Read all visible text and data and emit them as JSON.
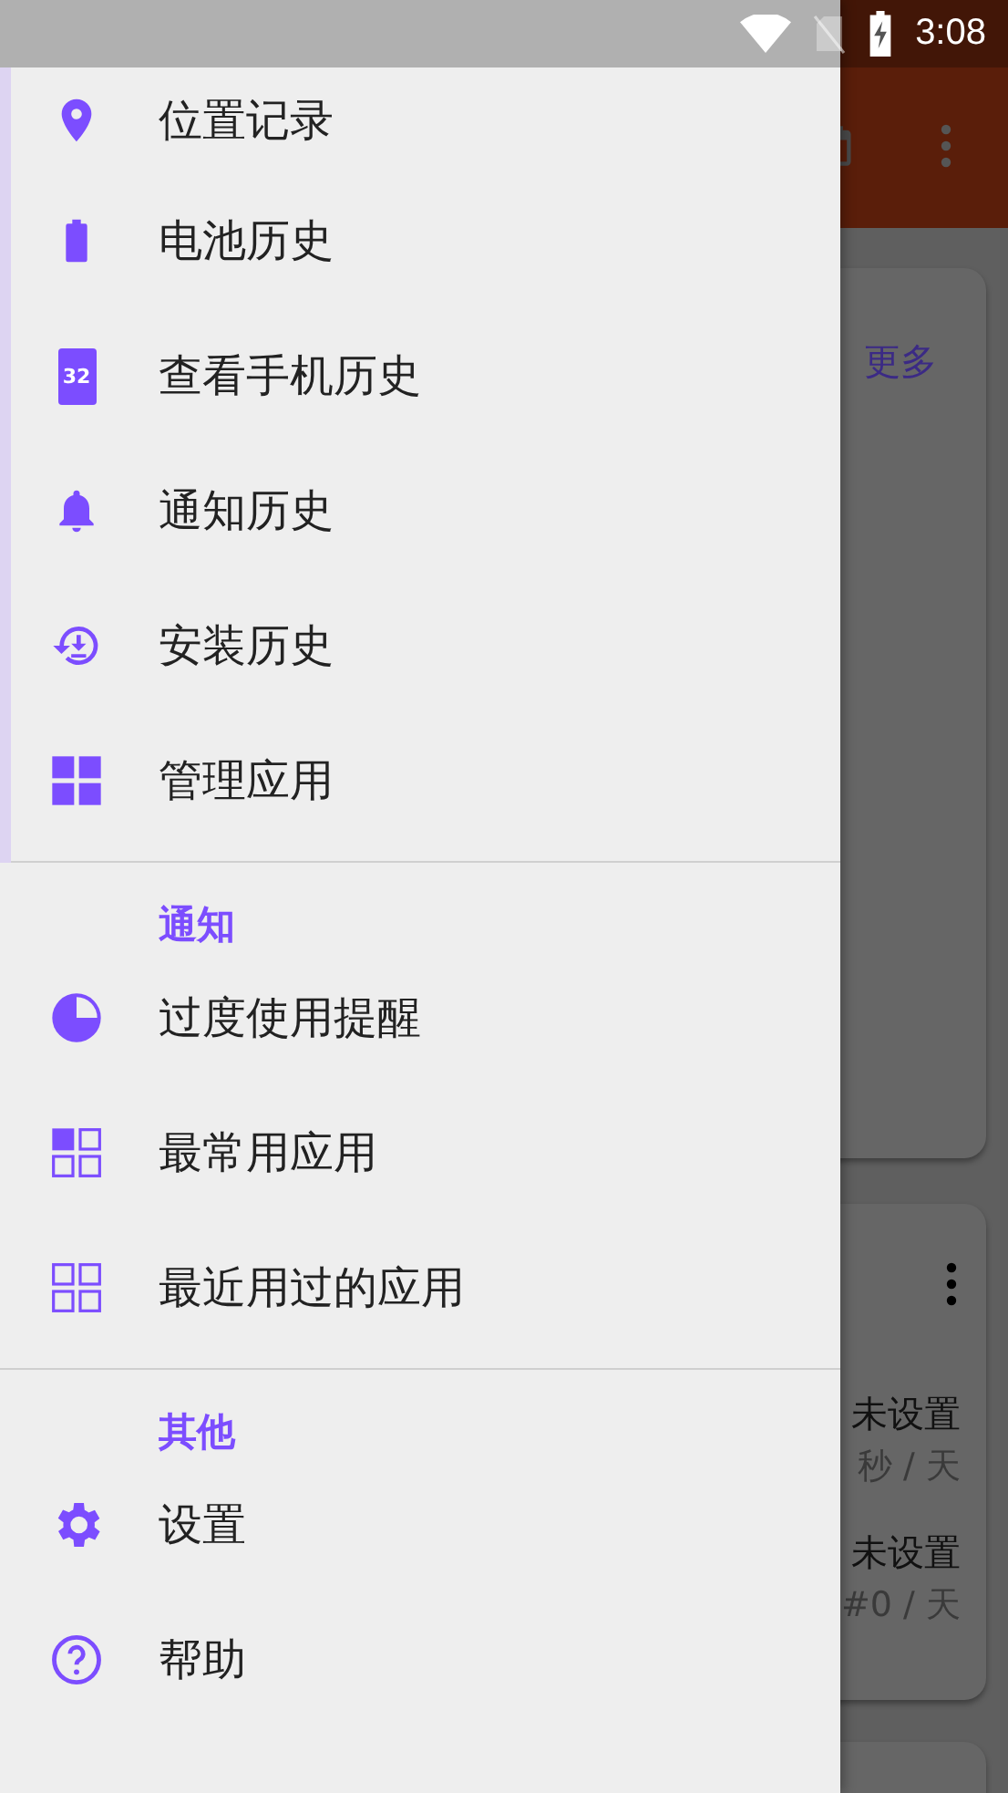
{
  "status_bar": {
    "time": "3:08"
  },
  "background": {
    "card_link": "更多",
    "cards": [
      {
        "value": "未设置",
        "detail": "秒 / 天"
      },
      {
        "value": "未设置",
        "detail": "#0 / 天"
      }
    ]
  },
  "drawer": {
    "sections": [
      {
        "items": [
          {
            "label": "位置记录",
            "kind": "pin"
          },
          {
            "label": "电池历史",
            "kind": "battery"
          },
          {
            "label": "查看手机历史",
            "kind": "calendar",
            "icon_text": "32"
          },
          {
            "label": "通知历史",
            "kind": "bell"
          },
          {
            "label": "安装历史",
            "kind": "install"
          },
          {
            "label": "管理应用",
            "kind": "grid"
          }
        ]
      },
      {
        "header": "通知",
        "items": [
          {
            "label": "过度使用提醒",
            "kind": "pie"
          },
          {
            "label": "最常用应用",
            "kind": "gridone"
          },
          {
            "label": "最近用过的应用",
            "kind": "gridoutline"
          }
        ]
      },
      {
        "header": "其他",
        "items": [
          {
            "label": "设置",
            "kind": "gear"
          },
          {
            "label": "帮助",
            "kind": "help"
          }
        ]
      }
    ]
  }
}
